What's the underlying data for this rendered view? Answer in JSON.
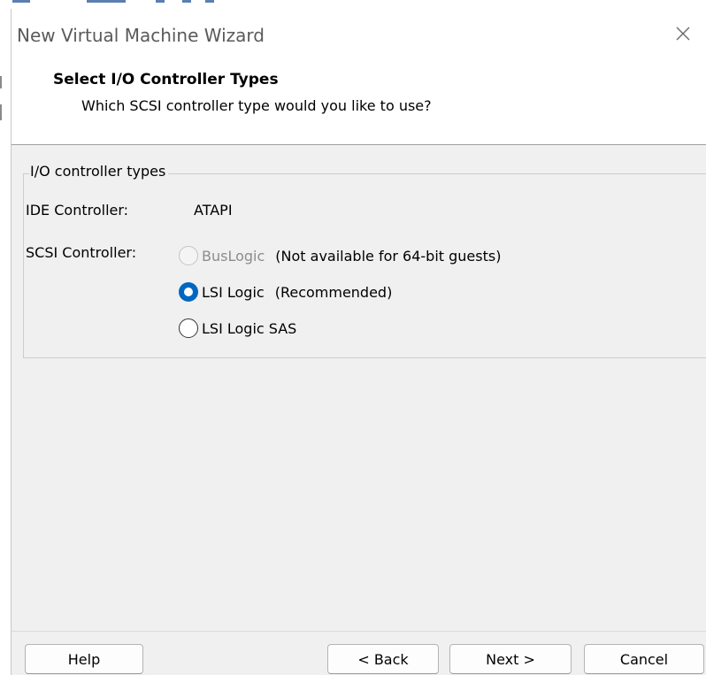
{
  "window": {
    "title": "New Virtual Machine Wizard"
  },
  "header": {
    "title": "Select I/O Controller Types",
    "subtitle": "Which SCSI controller type would you like to use?"
  },
  "controllers": {
    "group_label": "I/O controller types",
    "ide_label": "IDE Controller:",
    "ide_value": "ATAPI",
    "scsi_label": "SCSI Controller:",
    "options": [
      {
        "label": "BusLogic",
        "note": "(Not available for 64-bit guests)",
        "checked": false,
        "disabled": true
      },
      {
        "label": "LSI Logic",
        "note": "(Recommended)",
        "checked": true,
        "disabled": false
      },
      {
        "label": "LSI Logic SAS",
        "note": "",
        "checked": false,
        "disabled": false
      }
    ]
  },
  "buttons": {
    "help": "Help",
    "back": "< Back",
    "next": "Next >",
    "cancel": "Cancel"
  },
  "icons": {
    "close": "close-icon"
  },
  "colors": {
    "accent": "#0067c0",
    "dialog_bg": "#f0f0f0",
    "header_bg": "#ffffff",
    "disabled_text": "#8c8c8c"
  }
}
